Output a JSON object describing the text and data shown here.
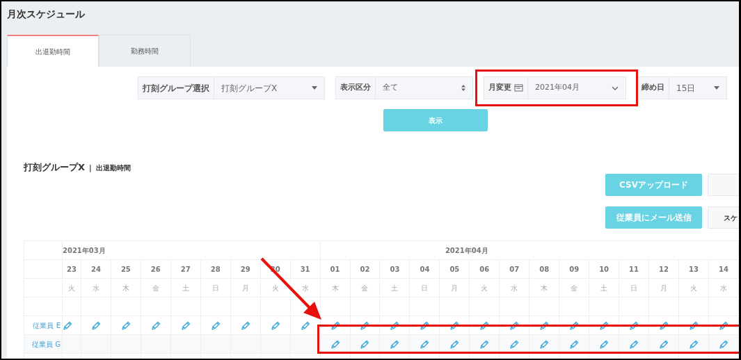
{
  "page_title": "月次スケジュール",
  "tabs": [
    {
      "label": "出退勤時間",
      "selected": true
    },
    {
      "label": "勤務時間",
      "selected": false
    }
  ],
  "filters": [
    {
      "label": "打刻グループ選択",
      "value": "打刻グループX",
      "kind": "dropdown"
    },
    {
      "label": "表示区分",
      "value": "全て",
      "kind": "spinner"
    },
    {
      "label": "月変更",
      "value": "2021年04月",
      "kind": "month"
    },
    {
      "label": "締め日",
      "value": "15日",
      "kind": "dropdown"
    }
  ],
  "show_button": "表示",
  "section": {
    "title": "打刻グループX",
    "separator": "|",
    "subtitle": "出退勤時間"
  },
  "action_rows": [
    [
      "CSVアップロード",
      ""
    ],
    [
      "従業員にメール送信",
      "スケ"
    ]
  ],
  "months": [
    {
      "label": "2021年03月",
      "days": [
        {
          "date": "23",
          "weekday": "火"
        },
        {
          "date": "24",
          "weekday": "水"
        },
        {
          "date": "25",
          "weekday": "木"
        },
        {
          "date": "26",
          "weekday": "金"
        },
        {
          "date": "27",
          "weekday": "土"
        },
        {
          "date": "28",
          "weekday": "日"
        },
        {
          "date": "29",
          "weekday": "月"
        },
        {
          "date": "30",
          "weekday": "火"
        },
        {
          "date": "31",
          "weekday": "水"
        }
      ]
    },
    {
      "label": "2021年04月",
      "days": [
        {
          "date": "01",
          "weekday": "木"
        },
        {
          "date": "02",
          "weekday": "金"
        },
        {
          "date": "03",
          "weekday": "土"
        },
        {
          "date": "04",
          "weekday": "日"
        },
        {
          "date": "05",
          "weekday": "月"
        },
        {
          "date": "06",
          "weekday": "火"
        },
        {
          "date": "07",
          "weekday": "水"
        },
        {
          "date": "08",
          "weekday": "木"
        },
        {
          "date": "09",
          "weekday": "金"
        },
        {
          "date": "10",
          "weekday": "土"
        },
        {
          "date": "11",
          "weekday": "日"
        },
        {
          "date": "12",
          "weekday": "月"
        },
        {
          "date": "13",
          "weekday": "火"
        },
        {
          "date": "14",
          "weekday": "水"
        }
      ]
    }
  ],
  "employees": [
    {
      "name": "従業員 E",
      "editable": [
        true,
        true,
        true,
        true,
        true,
        true,
        true,
        true,
        true,
        true,
        true,
        true,
        true,
        true,
        true,
        true,
        true,
        true,
        true,
        true,
        true,
        true,
        true
      ]
    },
    {
      "name": "従業員 G",
      "editable": [
        false,
        false,
        false,
        false,
        false,
        false,
        false,
        false,
        false,
        true,
        true,
        true,
        true,
        true,
        true,
        true,
        true,
        true,
        true,
        true,
        true,
        true,
        true
      ]
    }
  ]
}
